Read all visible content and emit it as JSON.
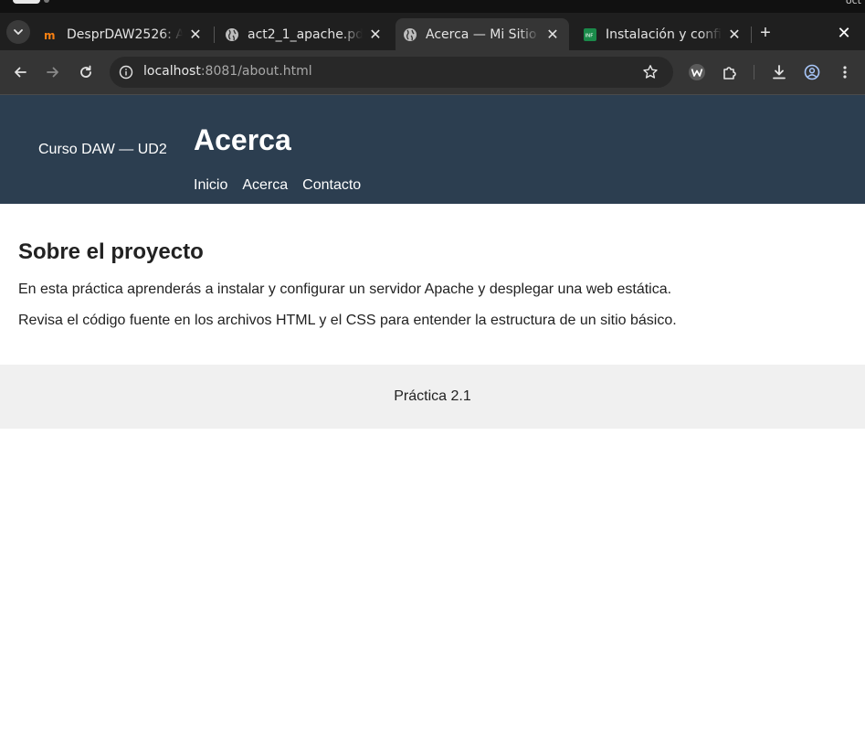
{
  "os": {
    "clock": "oct"
  },
  "browser": {
    "tabs": [
      {
        "title": "DesprDAW2526: A",
        "favicon": "moodle-icon",
        "active": false
      },
      {
        "title": "act2_1_apache.pd",
        "favicon": "globe-icon",
        "active": false
      },
      {
        "title": "Acerca — Mi Sitio",
        "favicon": "globe-icon",
        "active": true
      },
      {
        "title": "Instalación y confi",
        "favicon": "sheet-icon",
        "active": false
      }
    ],
    "url_host": "localhost",
    "url_path": ":8081/about.html"
  },
  "site": {
    "brand": "Curso DAW — UD2",
    "title": "Acerca",
    "nav": [
      "Inicio",
      "Acerca",
      "Contacto"
    ]
  },
  "main": {
    "heading": "Sobre el proyecto",
    "paragraphs": [
      "En esta práctica aprenderás a instalar y configurar un servidor Apache y desplegar una web estática.",
      "Revisa el código fuente en los archivos HTML y el CSS para entender la estructura de un sitio básico."
    ]
  },
  "footer": {
    "text": "Práctica 2.1"
  },
  "colors": {
    "header_bg": "#2c3e50",
    "footer_bg": "#f0f0f0",
    "tab_bar": "#1f1f1f",
    "toolbar": "#353535"
  }
}
